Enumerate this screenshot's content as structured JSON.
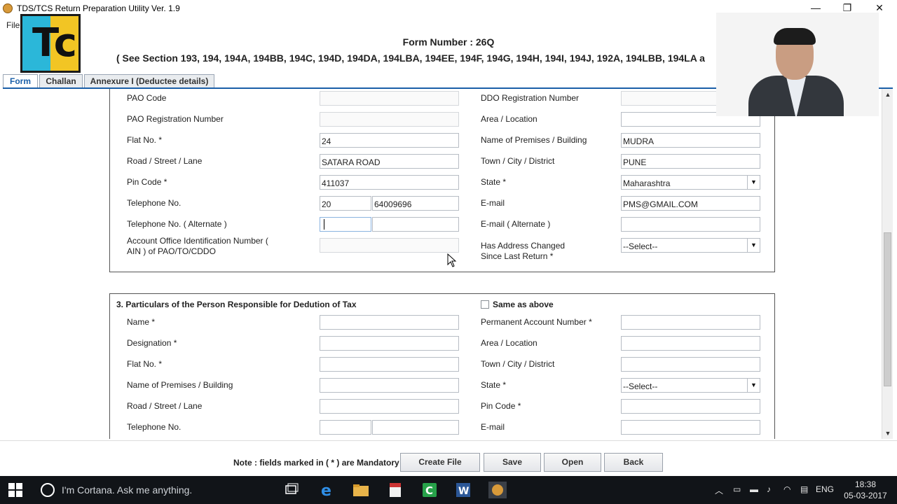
{
  "window": {
    "title": "TDS/TCS Return Preparation Utility Ver. 1.9",
    "minimize_glyph": "—",
    "maximize_glyph": "❐",
    "close_glyph": "✕"
  },
  "menu": {
    "file": "File"
  },
  "logo": {
    "letter": "Tc"
  },
  "header": {
    "form_number": "Form Number : 26Q",
    "section_ref": "( See Section 193, 194, 194A, 194BB, 194C, 194D, 194DA, 194LBA, 194EE, 194F, 194G, 194H, 194I, 194J, 192A, 194LBB, 194LA a"
  },
  "tabs": [
    {
      "label": "Form"
    },
    {
      "label": "Challan"
    },
    {
      "label": "Annexure I (Deductee details)"
    }
  ],
  "deductor_address": {
    "pao_code": {
      "label": "PAO Code",
      "value": ""
    },
    "ddo_reg": {
      "label": "DDO Registration Number",
      "value": ""
    },
    "pao_reg": {
      "label": "PAO Registration Number",
      "value": ""
    },
    "area": {
      "label": "Area / Location",
      "value": ""
    },
    "flat": {
      "label": "Flat No. *",
      "value": "24"
    },
    "premises": {
      "label": "Name of Premises / Building",
      "value": "MUDRA"
    },
    "road": {
      "label": "Road / Street / Lane",
      "value": "SATARA ROAD"
    },
    "town": {
      "label": "Town / City / District",
      "value": "PUNE"
    },
    "pin": {
      "label": "Pin Code *",
      "value": "411037"
    },
    "state": {
      "label": "State *",
      "value": "Maharashtra"
    },
    "telephone": {
      "label": "Telephone No.",
      "std": "20",
      "number": "64009696"
    },
    "email": {
      "label": "E-mail",
      "value": "PMS@GMAIL.COM"
    },
    "telephone_alt": {
      "label": "Telephone No. ( Alternate )",
      "std": "",
      "number": ""
    },
    "email_alt": {
      "label": "E-mail ( Alternate )",
      "value": ""
    },
    "ain": {
      "label": "Account Office Identification Number ( AIN ) of PAO/TO/CDDO",
      "value": ""
    },
    "address_changed": {
      "label": "Has Address Changed Since Last Return *",
      "value": "--Select--"
    }
  },
  "responsible_person": {
    "title": "3. Particulars of the Person Responsible for Dedution of Tax",
    "same_as_above": "Same as above",
    "name": {
      "label": "Name *",
      "value": ""
    },
    "pan": {
      "label": "Permanent Account Number *",
      "value": ""
    },
    "designation": {
      "label": "Designation *",
      "value": ""
    },
    "area": {
      "label": "Area / Location",
      "value": ""
    },
    "flat": {
      "label": "Flat No. *",
      "value": ""
    },
    "town": {
      "label": "Town / City / District",
      "value": ""
    },
    "premises": {
      "label": "Name of Premises / Building",
      "value": ""
    },
    "state": {
      "label": "State *",
      "value": "--Select--"
    },
    "road": {
      "label": "Road / Street / Lane",
      "value": ""
    },
    "pin": {
      "label": "Pin Code *",
      "value": ""
    },
    "telephone": {
      "label": "Telephone No.",
      "std": "",
      "number": ""
    },
    "email": {
      "label": "E-mail",
      "value": ""
    }
  },
  "footer": {
    "note": "Note : fields marked in ( * ) are Mandatory",
    "create_file": "Create File",
    "save": "Save",
    "open": "Open",
    "back": "Back"
  },
  "taskbar": {
    "cortana": "I'm Cortana. Ask me anything.",
    "language": "ENG",
    "time": "18:38",
    "date": "05-03-2017"
  },
  "icons": {
    "dropdown_arrow": "▼",
    "scroll_up": "▲",
    "scroll_down": "▼"
  },
  "colors": {
    "accent": "#1a5fa8",
    "taskbar": "#111418",
    "logo_cyan": "#2bb7d9",
    "logo_yellow": "#f2c524"
  }
}
